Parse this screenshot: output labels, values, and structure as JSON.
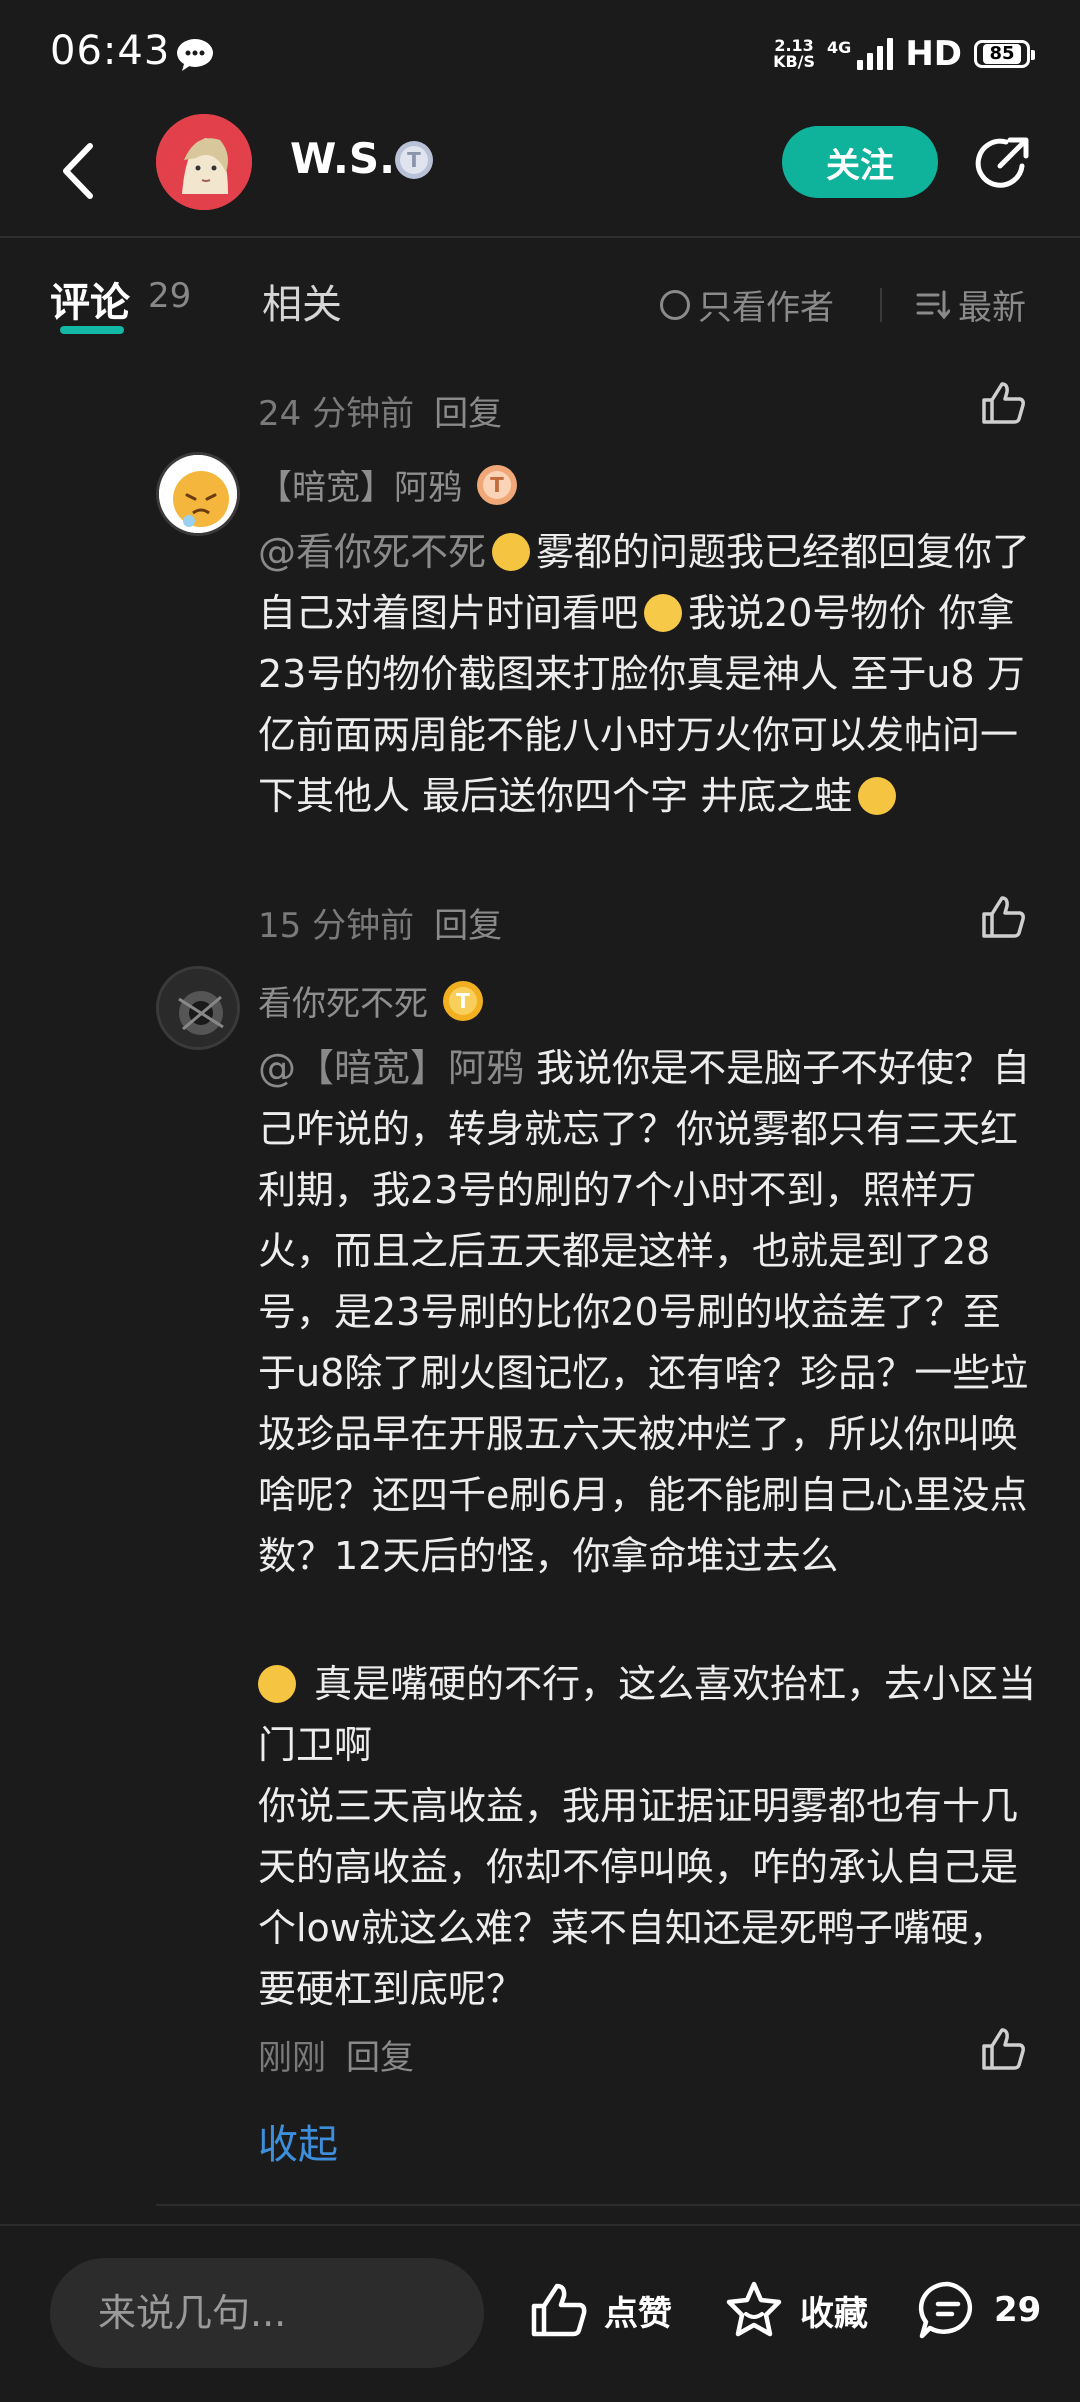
{
  "status": {
    "time": "06:43",
    "net_speed": "2.13",
    "net_unit": "KB/S",
    "signal_type": "4G",
    "hd": "HD",
    "battery": "85"
  },
  "header": {
    "username": "W.S.",
    "level_badge": "T",
    "follow_label": "关注"
  },
  "tabs": {
    "comments_label": "评论",
    "comments_count": "29",
    "related_label": "相关",
    "author_only_label": "只看作者",
    "sort_label": "最新"
  },
  "comments": [
    {
      "time": "24 分钟前",
      "reply": "回复"
    },
    {
      "name": "【暗宽】阿鸦",
      "badge": "T",
      "mention": "@看你死不死",
      "text_a": "雾都的问题我已经都回复你了 自己对着图片时间看吧",
      "text_b": "我说20号物价 你拿23号的物价截图来打脸你真是神人  至于u8  万亿前面两周能不能八小时万火你可以发帖问一下其他人 最后送你四个字 井底之蛙",
      "time": "15 分钟前",
      "reply": "回复"
    },
    {
      "name": "看你死不死",
      "badge": "T",
      "mention": "@【暗宽】阿鸦",
      "text_a": "我说你是不是脑子不好使？自己咋说的，转身就忘了？你说雾都只有三天红利期，我23号的刷的7个小时不到，照样万火，而且之后五天都是这样，也就是到了28号，是23号刷的比你20号刷的收益差了？至于u8除了刷火图记忆，还有啥？珍品？一些垃圾珍品早在开服五六天被冲烂了，所以你叫唤啥呢？还四千e刷6月，能不能刷自己心里没点数？12天后的怪，你拿命堆过去么",
      "text_b": "真是嘴硬的不行，这么喜欢抬杠，去小区当门卫啊",
      "text_c": "你说三天高收益，我用证据证明雾都也有十几天的高收益，你却不停叫唤，咋的承认自己是个low就这么难？菜不自知还是死鸭子嘴硬，要硬杠到底呢？",
      "time": "刚刚",
      "reply": "回复"
    }
  ],
  "collapse_label": "收起",
  "bottom": {
    "input_placeholder": "来说几句...",
    "like_label": "点赞",
    "fav_label": "收藏",
    "comment_count": "29"
  }
}
